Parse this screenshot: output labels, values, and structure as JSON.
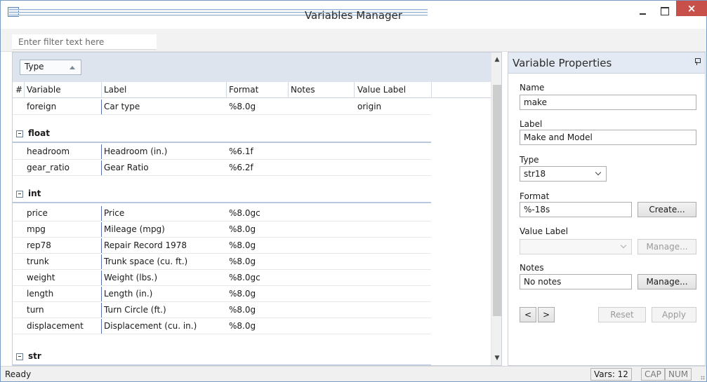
{
  "window": {
    "title": "Variables Manager",
    "close_glyph": "×"
  },
  "filter": {
    "placeholder": "Enter filter text here"
  },
  "grid": {
    "group_by_label": "Type",
    "columns": [
      "#",
      "Variable",
      "Label",
      "Format",
      "Notes",
      "Value Label"
    ],
    "rows": [
      {
        "variable": "foreign",
        "label": "Car type",
        "format": "%8.0g",
        "notes": "",
        "value_label": "origin"
      }
    ],
    "groups": [
      {
        "name": "float",
        "rows": [
          {
            "variable": "headroom",
            "label": "Headroom (in.)",
            "format": "%6.1f"
          },
          {
            "variable": "gear_ratio",
            "label": "Gear Ratio",
            "format": "%6.2f"
          }
        ]
      },
      {
        "name": "int",
        "rows": [
          {
            "variable": "price",
            "label": "Price",
            "format": "%8.0gc"
          },
          {
            "variable": "mpg",
            "label": "Mileage (mpg)",
            "format": "%8.0g"
          },
          {
            "variable": "rep78",
            "label": "Repair Record 1978",
            "format": "%8.0g"
          },
          {
            "variable": "trunk",
            "label": "Trunk space (cu. ft.)",
            "format": "%8.0g"
          },
          {
            "variable": "weight",
            "label": "Weight (lbs.)",
            "format": "%8.0gc"
          },
          {
            "variable": "length",
            "label": "Length (in.)",
            "format": "%8.0g"
          },
          {
            "variable": "turn",
            "label": "Turn Circle (ft.)",
            "format": "%8.0g"
          },
          {
            "variable": "displacement",
            "label": "Displacement (cu. in.)",
            "format": "%8.0g"
          }
        ]
      },
      {
        "name": "str",
        "rows": []
      }
    ]
  },
  "properties": {
    "title": "Variable Properties",
    "name_label": "Name",
    "name_value": "make",
    "label_label": "Label",
    "label_value": "Make and Model",
    "type_label": "Type",
    "type_value": "str18",
    "format_label": "Format",
    "format_value": "%-18s",
    "create_button": "Create...",
    "value_label_label": "Value Label",
    "value_label_value": "",
    "manage_value_label_button": "Manage...",
    "notes_label": "Notes",
    "notes_value": "No notes",
    "manage_notes_button": "Manage...",
    "prev_button": "<",
    "next_button": ">",
    "reset_button": "Reset",
    "apply_button": "Apply"
  },
  "status": {
    "text": "Ready",
    "vars": "Vars: 12",
    "cap": "CAP",
    "num": "NUM"
  }
}
